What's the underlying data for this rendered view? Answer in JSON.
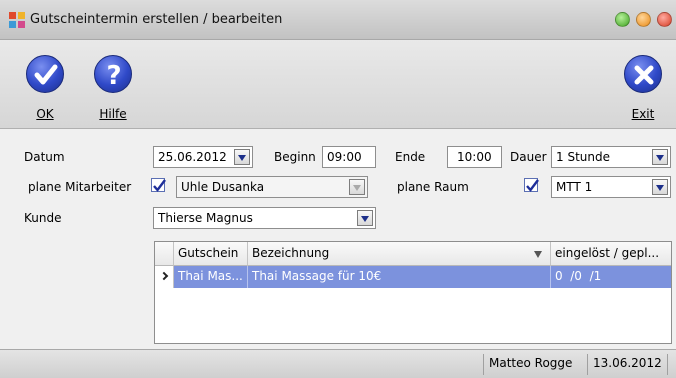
{
  "window": {
    "title": "Gutscheintermin erstellen / bearbeiten",
    "controls": [
      "minimize-icon",
      "maximize-icon",
      "close-icon"
    ]
  },
  "toolbar": {
    "ok_label": "OK",
    "help_label": "Hilfe",
    "exit_label": "Exit"
  },
  "form": {
    "datum_label": "Datum",
    "datum_value": "25.06.2012",
    "beginn_label": "Beginn",
    "beginn_value": "09:00",
    "ende_label": "Ende",
    "ende_value": "10:00",
    "dauer_label": "Dauer",
    "dauer_value": "1 Stunde",
    "plane_mitarbeiter_label": "plane Mitarbeiter",
    "plane_mitarbeiter_checked": true,
    "mitarbeiter_value": "Uhle Dusanka",
    "plane_raum_label": "plane Raum",
    "plane_raum_checked": true,
    "raum_value": "MTT 1",
    "kunde_label": "Kunde",
    "kunde_value": "Thierse Magnus"
  },
  "grid": {
    "columns": [
      "Gutschein",
      "Bezeichnung",
      "eingelöst / gepl..."
    ],
    "rows": [
      {
        "gutschein": "Thai Mas...",
        "bezeichnung": "Thai Massage für 10€",
        "status": "0  /0  /1"
      }
    ]
  },
  "statusbar": {
    "user": "Matteo Rogge",
    "date": "13.06.2012"
  },
  "colors": {
    "accent": "#2f49c8",
    "selection": "#7c92dd",
    "form_bg": "#f0f0f0"
  }
}
